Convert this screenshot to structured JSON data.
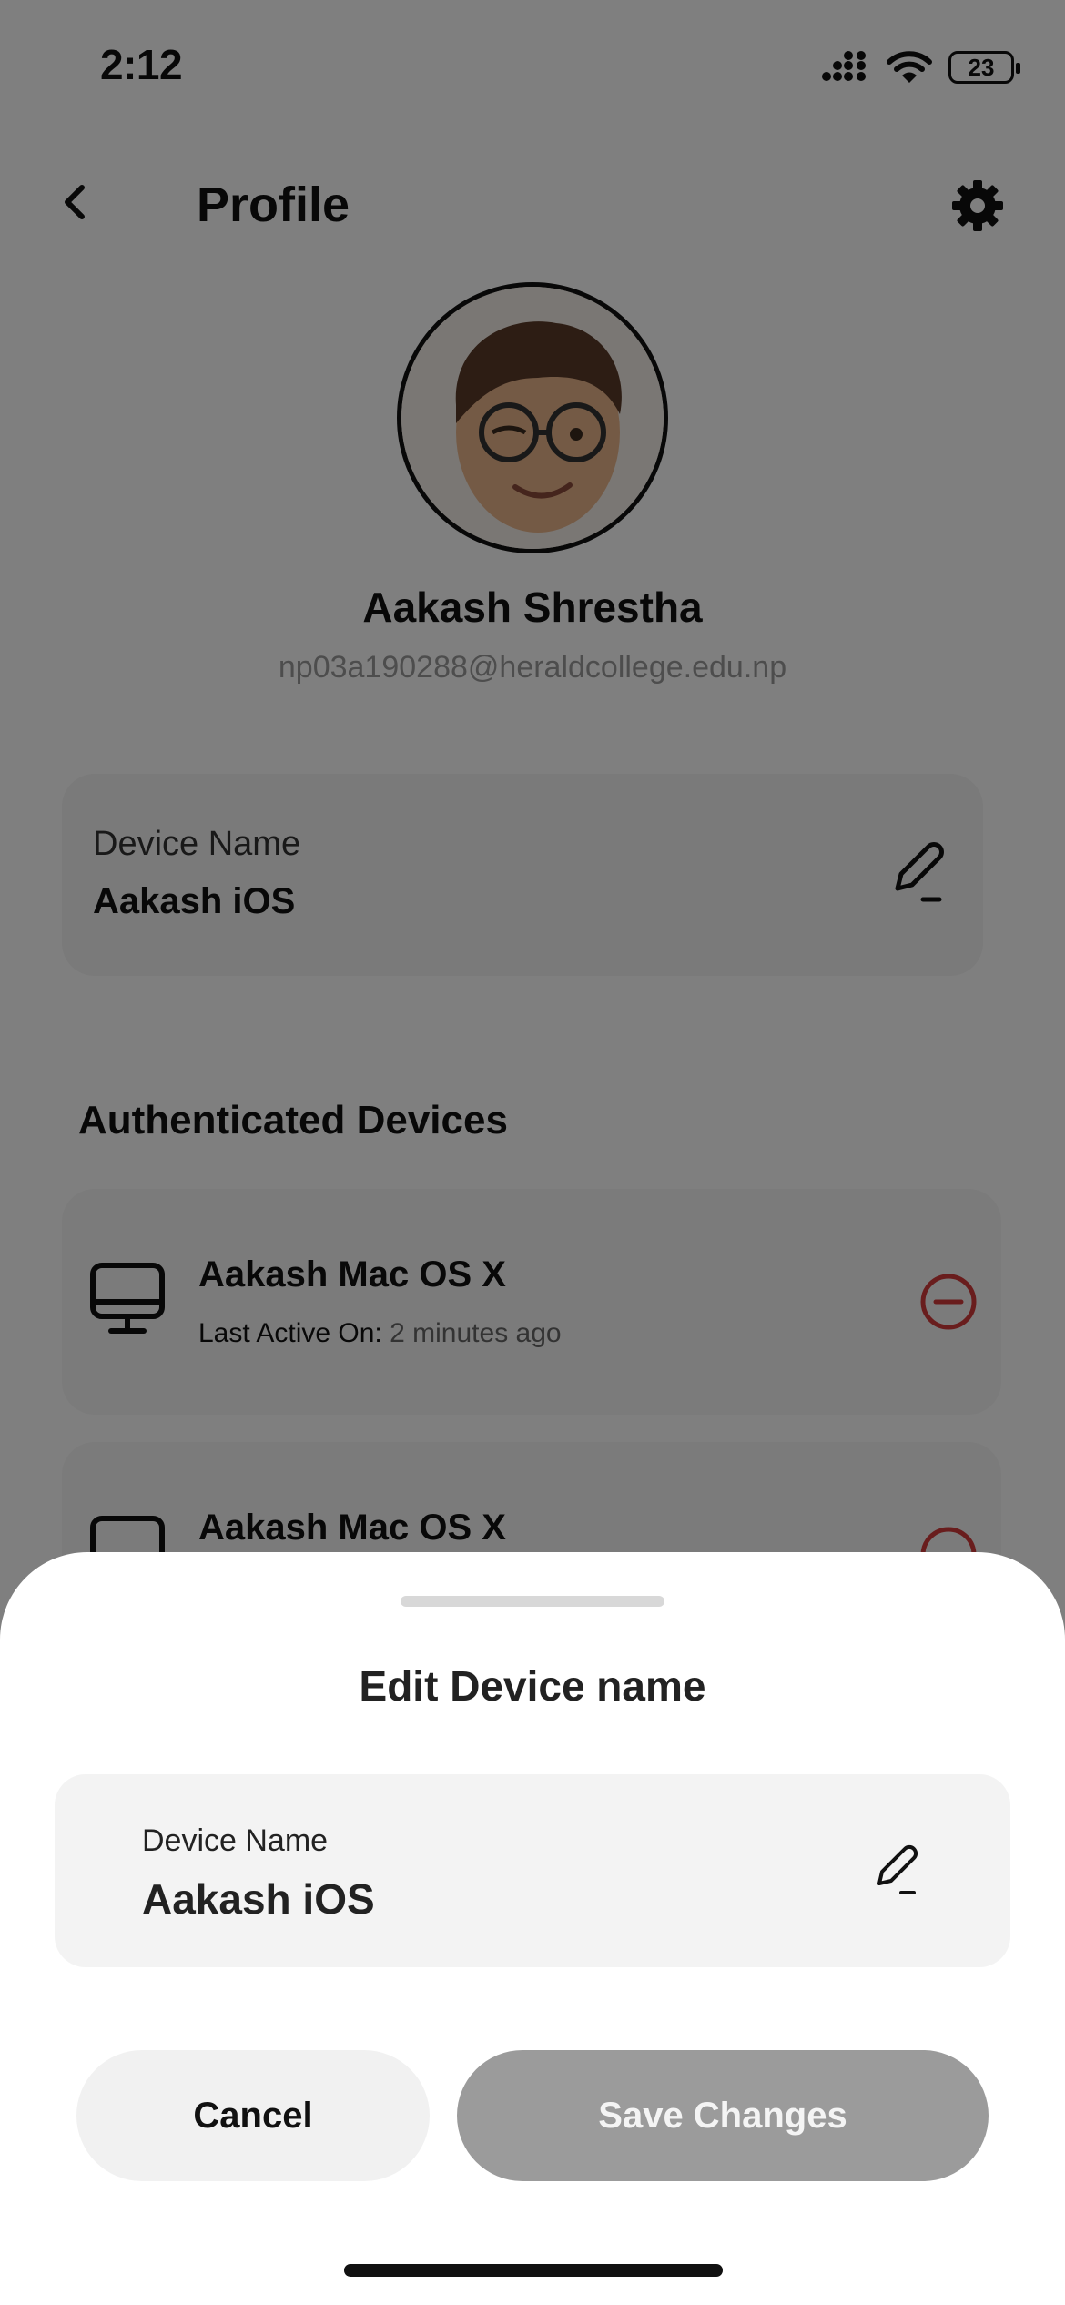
{
  "status_bar": {
    "time": "2:12",
    "battery": "23"
  },
  "header": {
    "title": "Profile"
  },
  "profile": {
    "name": "Aakash Shrestha",
    "email": "np03a190288@heraldcollege.edu.np"
  },
  "device_card": {
    "label": "Device Name",
    "value": "Aakash iOS"
  },
  "authenticated": {
    "title": "Authenticated Devices",
    "items": [
      {
        "name": "Aakash Mac OS X",
        "active_label": "Last Active On:",
        "active_time": "2 minutes ago"
      },
      {
        "name": "Aakash Mac OS X"
      }
    ]
  },
  "sheet": {
    "title": "Edit Device name",
    "field_label": "Device Name",
    "field_value": "Aakash iOS",
    "cancel_label": "Cancel",
    "save_label": "Save Changes"
  },
  "colors": {
    "remove": "#d23b3b",
    "save_disabled": "#9b9b9b",
    "overlay": "rgba(0,0,0,0.5)"
  },
  "icons": [
    "back-icon",
    "gear-icon",
    "pencil-edit-icon",
    "desktop-icon",
    "minus-circle-icon",
    "signal-icon",
    "wifi-icon",
    "battery-icon"
  ]
}
